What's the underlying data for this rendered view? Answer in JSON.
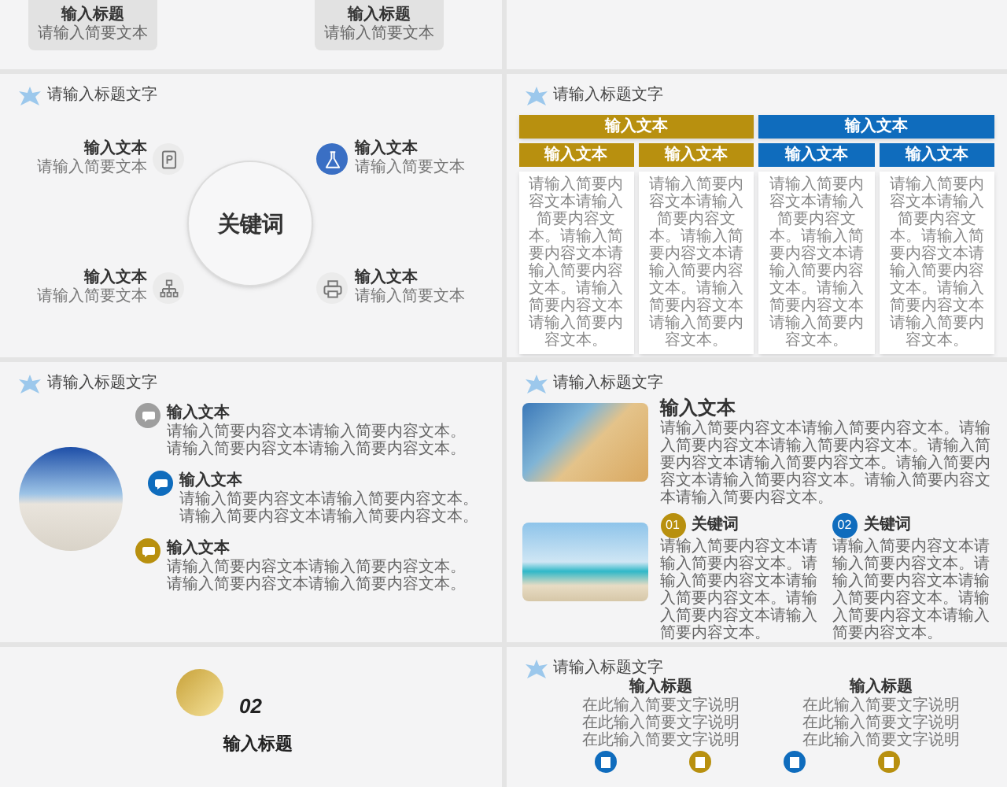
{
  "slide_cards": {
    "cards": [
      {
        "title": "输入标题",
        "text": "请输入简要文本"
      },
      {
        "title": "输入标题",
        "text": "请输入简要文本"
      }
    ]
  },
  "slide_keyword": {
    "title": "请输入标题文字",
    "center": "关键词",
    "items": [
      {
        "label": "输入文本",
        "text": "请输入简要文本",
        "highlighted": false
      },
      {
        "label": "输入文本",
        "text": "请输入简要文本",
        "highlighted": true
      },
      {
        "label": "输入文本",
        "text": "请输入简要文本",
        "highlighted": false
      },
      {
        "label": "输入文本",
        "text": "请输入简要文本",
        "highlighted": false
      }
    ]
  },
  "slide_table": {
    "title": "请输入标题文字",
    "groups": [
      {
        "label": "输入文本",
        "color": "#b8900f",
        "columns": [
          {
            "label": "输入文本",
            "text": "请输入简要内容文本请输入简要内容文本。请输入简要内容文本请输入简要内容文本。请输入简要内容文本请输入简要内容文本。"
          },
          {
            "label": "输入文本",
            "text": "请输入简要内容文本请输入简要内容文本。请输入简要内容文本请输入简要内容文本。请输入简要内容文本请输入简要内容文本。"
          }
        ]
      },
      {
        "label": "输入文本",
        "color": "#0f6cbd",
        "columns": [
          {
            "label": "输入文本",
            "text": "请输入简要内容文本请输入简要内容文本。请输入简要内容文本请输入简要内容文本。请输入简要内容文本请输入简要内容文本。"
          },
          {
            "label": "输入文本",
            "text": "请输入简要内容文本请输入简要内容文本。请输入简要内容文本请输入简要内容文本。请输入简要内容文本请输入简要内容文本。"
          }
        ]
      }
    ]
  },
  "slide_circle_list": {
    "title": "请输入标题文字",
    "items": [
      {
        "label": "输入文本",
        "color": "#9e9e9e",
        "lines": [
          "请输入简要内容文本请输入简要内容文本。",
          "请输入简要内容文本请输入简要内容文本。"
        ]
      },
      {
        "label": "输入文本",
        "color": "#0f6cbd",
        "lines": [
          "请输入简要内容文本请输入简要内容文本。",
          "请输入简要内容文本请输入简要内容文本。"
        ]
      },
      {
        "label": "输入文本",
        "color": "#b8900f",
        "lines": [
          "请输入简要内容文本请输入简要内容文本。",
          "请输入简要内容文本请输入简要内容文本。"
        ]
      }
    ]
  },
  "slide_photos": {
    "title": "请输入标题文字",
    "heading": "输入文本",
    "text": "请输入简要内容文本请输入简要内容文本。请输入简要内容文本请输入简要内容文本。请输入简要内容文本请输入简要内容文本。请输入简要内容文本请输入简要内容文本。请输入简要内容文本请输入简要内容文本。",
    "items": [
      {
        "number": "01",
        "label": "关键词",
        "color": "#b8900f",
        "text": "请输入简要内容文本请输入简要内容文本。请输入简要内容文本请输入简要内容文本。请输入简要内容文本请输入简要内容文本。"
      },
      {
        "number": "02",
        "label": "关键词",
        "color": "#0f6cbd",
        "text": "请输入简要内容文本请输入简要内容文本。请输入简要内容文本请输入简要内容文本。请输入简要内容文本请输入简要内容文本。"
      }
    ]
  },
  "slide_section": {
    "number": "02",
    "title": "输入标题"
  },
  "slide_timeline": {
    "title": "请输入标题文字",
    "items": [
      {
        "label": "输入标题",
        "lines": [
          "在此输入简要文字说明",
          "在此输入简要文字说明",
          "在此输入简要文字说明"
        ]
      },
      {
        "label": "输入标题",
        "lines": [
          "在此输入简要文字说明",
          "在此输入简要文字说明",
          "在此输入简要文字说明"
        ]
      }
    ],
    "markers": [
      {
        "color": "#0f6cbd"
      },
      {
        "color": "#b8900f"
      },
      {
        "color": "#0f6cbd"
      },
      {
        "color": "#b8900f"
      }
    ]
  }
}
